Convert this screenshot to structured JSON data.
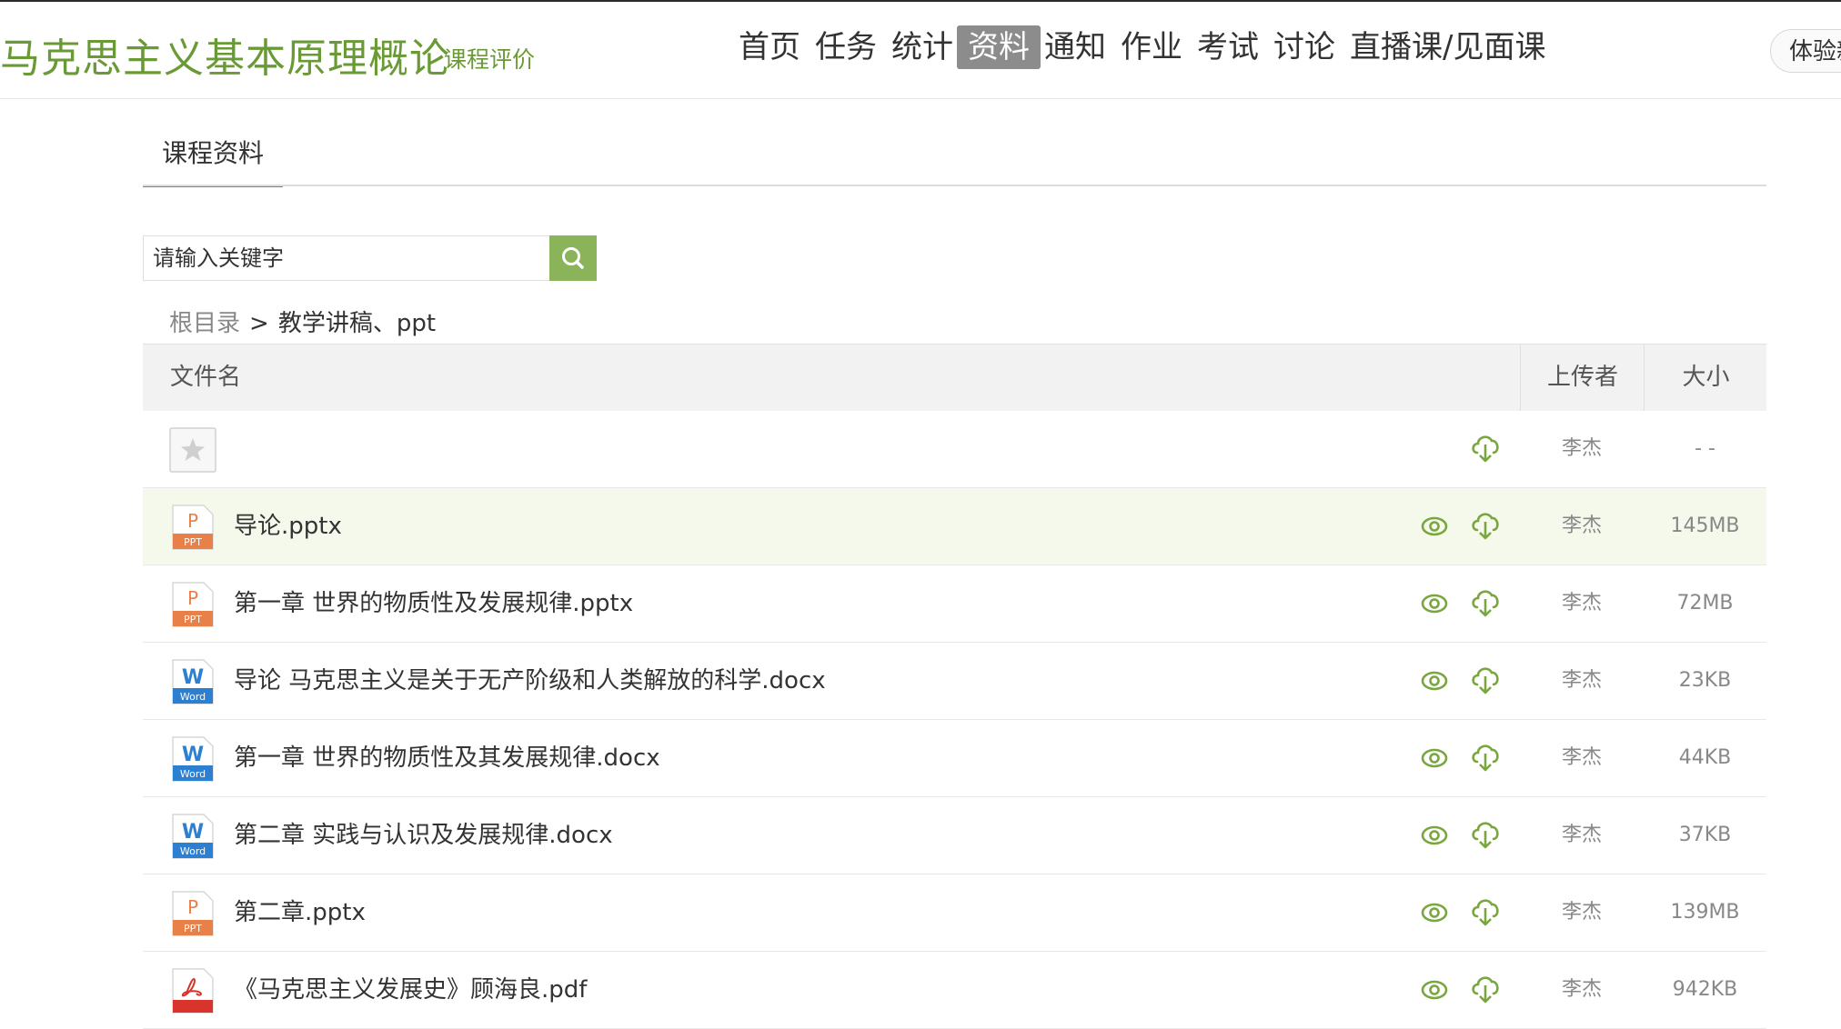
{
  "header": {
    "course_title": "马克思主义基本原理概论",
    "course_eval": "课程评价",
    "experience_button": "体验新版"
  },
  "nav": {
    "items": [
      {
        "label": "首页"
      },
      {
        "label": "任务"
      },
      {
        "label": "统计"
      },
      {
        "label": "资料",
        "active": true
      },
      {
        "label": "通知"
      },
      {
        "label": "作业"
      },
      {
        "label": "考试"
      },
      {
        "label": "讨论"
      },
      {
        "label": "直播课/见面课"
      }
    ]
  },
  "subnav": {
    "tab": "课程资料"
  },
  "search": {
    "placeholder": "请输入关键字"
  },
  "breadcrumb": {
    "root": "根目录",
    "separator": ">",
    "current": "教学讲稿、ppt"
  },
  "table": {
    "headers": {
      "name": "文件名",
      "uploader": "上传者",
      "size": "大小"
    },
    "rows": [
      {
        "icon": "star-folder-icon",
        "name": "",
        "uploader": "李杰",
        "size": "- -"
      },
      {
        "icon": "ppt-file-icon",
        "name": "导论.pptx",
        "uploader": "李杰",
        "size": "145MB"
      },
      {
        "icon": "ppt-file-icon",
        "name": "第一章 世界的物质性及发展规律.pptx",
        "uploader": "李杰",
        "size": "72MB"
      },
      {
        "icon": "word-file-icon",
        "name": "导论 马克思主义是关于无产阶级和人类解放的科学.docx",
        "uploader": "李杰",
        "size": "23KB"
      },
      {
        "icon": "word-file-icon",
        "name": "第一章 世界的物质性及其发展规律.docx",
        "uploader": "李杰",
        "size": "44KB"
      },
      {
        "icon": "word-file-icon",
        "name": "第二章 实践与认识及发展规律.docx",
        "uploader": "李杰",
        "size": "37KB"
      },
      {
        "icon": "ppt-file-icon",
        "name": "第二章.pptx",
        "uploader": "李杰",
        "size": "139MB"
      },
      {
        "icon": "pdf-file-icon",
        "name": "《马克思主义发展史》顾海良.pdf",
        "uploader": "李杰",
        "size": "942KB"
      }
    ]
  },
  "colors": {
    "accent": "#6a9a35",
    "search_button": "#8bb35a",
    "active_nav": "#8c8c8c",
    "row_highlight": "#f5f9ec",
    "ppt": "#e8804a",
    "word": "#2c7fd1",
    "pdf": "#d9342b"
  }
}
